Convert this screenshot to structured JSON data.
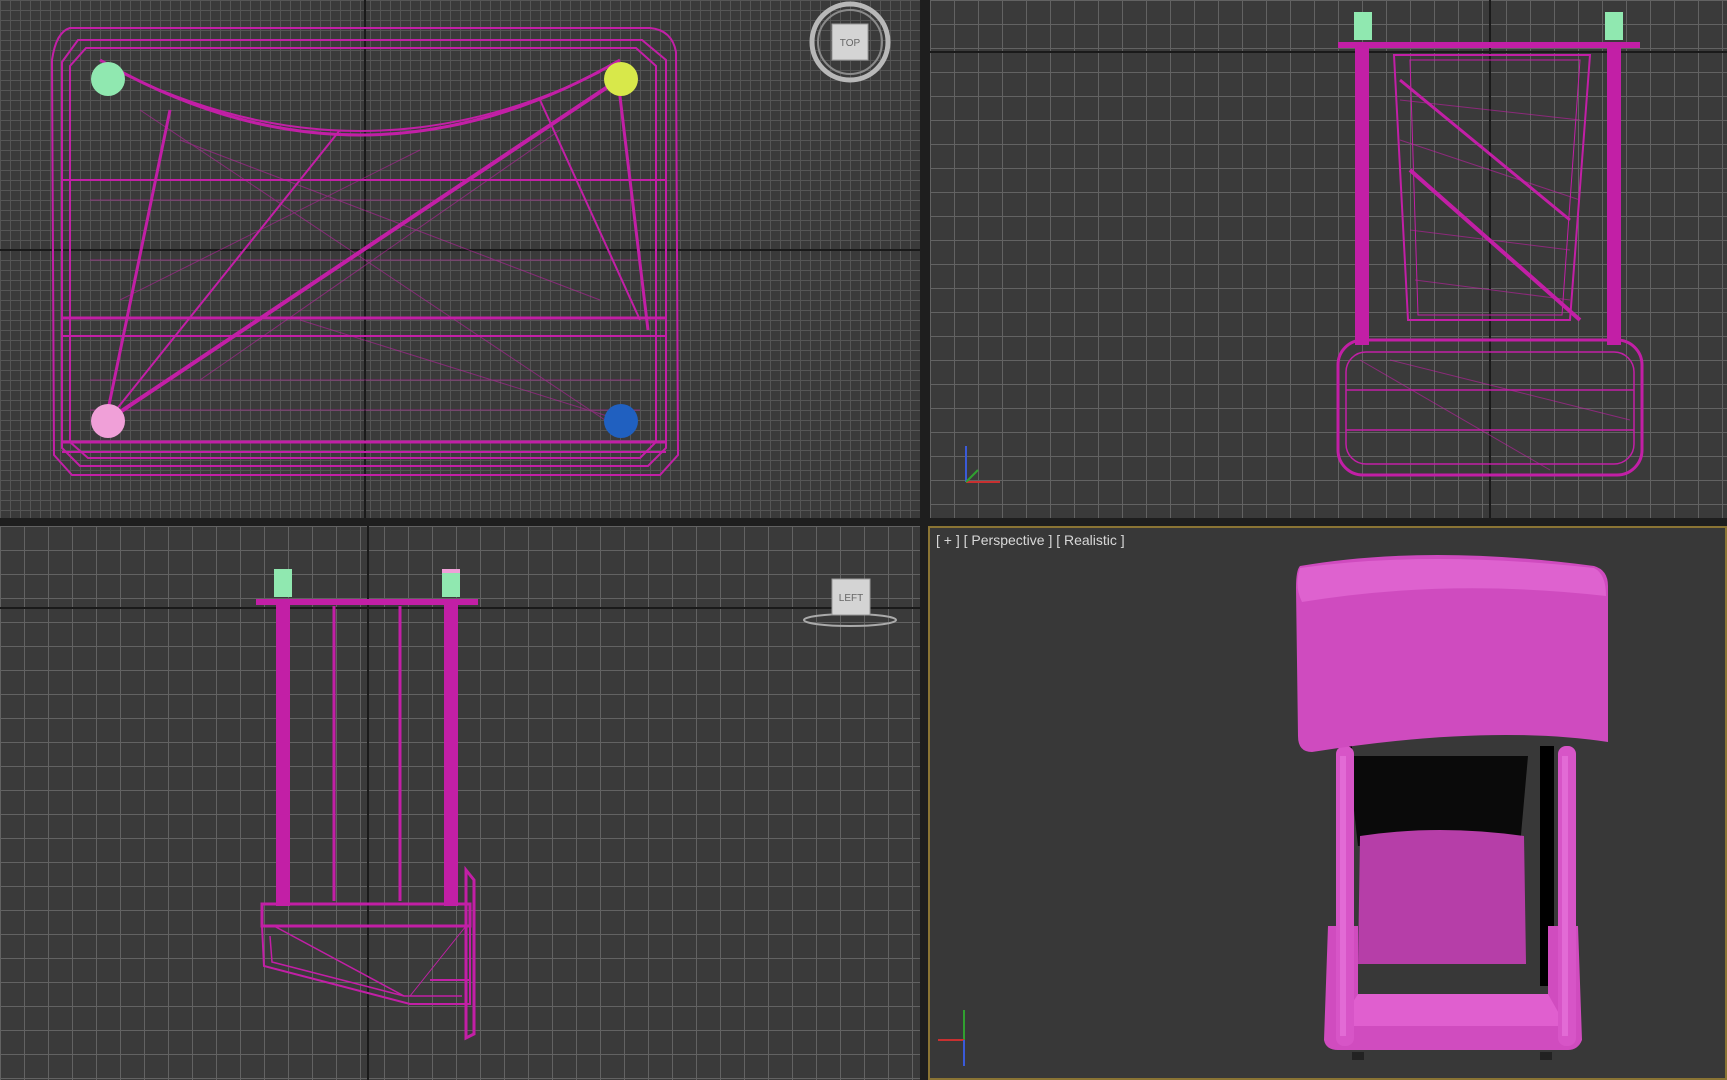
{
  "viewports": {
    "top": {
      "navcube_label": "TOP"
    },
    "front": {},
    "left": {
      "navcube_label": "LEFT"
    },
    "perspective": {
      "label_plus": "[ + ]",
      "label_view": "[ Perspective ]",
      "label_shading": "[ Realistic ]"
    }
  },
  "colors": {
    "wireframe": "#c21fa6",
    "shaded": "#cc44bb",
    "frame_active": "#8a7434",
    "marker_green": "#90e8b0",
    "marker_yellow": "#d8e84a",
    "marker_pink": "#f0a0d8",
    "marker_blue": "#2060c0"
  },
  "icons": {
    "viewcube": "viewcube-icon",
    "axis": "axis-tripod-icon"
  }
}
